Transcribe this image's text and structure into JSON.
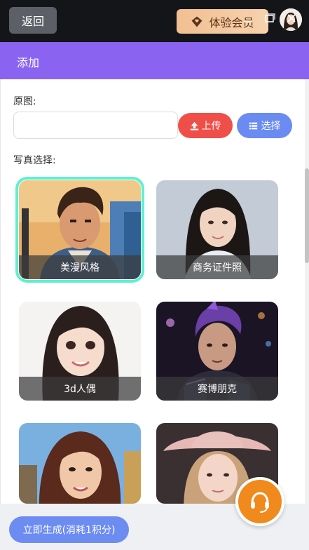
{
  "topbar": {
    "back_label": "返回",
    "vip_label": "体验会员",
    "vip_icon": "diamond-heart-icon",
    "avatar_icon": "user-avatar"
  },
  "dialog": {
    "title": "添加",
    "controls": [
      "minimize-icon",
      "maximize-icon",
      "close-icon"
    ],
    "original_label": "原图:",
    "path_value": "",
    "path_placeholder": "",
    "upload_label": "上传",
    "choose_label": "选择",
    "photo_label": "写真选择:",
    "styles": [
      {
        "name": "美漫风格",
        "selected": true
      },
      {
        "name": "商务证件照",
        "selected": false
      },
      {
        "name": "3d人偶",
        "selected": false
      },
      {
        "name": "赛博朋克",
        "selected": false
      },
      {
        "name": "",
        "selected": false
      },
      {
        "name": "",
        "selected": false
      }
    ]
  },
  "footer": {
    "generate_label": "立即生成(消耗1积分)"
  },
  "colors": {
    "topbar": "#141518",
    "header": "#8a63f0",
    "upload": "#ef4f48",
    "choose": "#6a8bf2",
    "selected_outline": "#5ff0d0",
    "support": "#f08a1c"
  }
}
